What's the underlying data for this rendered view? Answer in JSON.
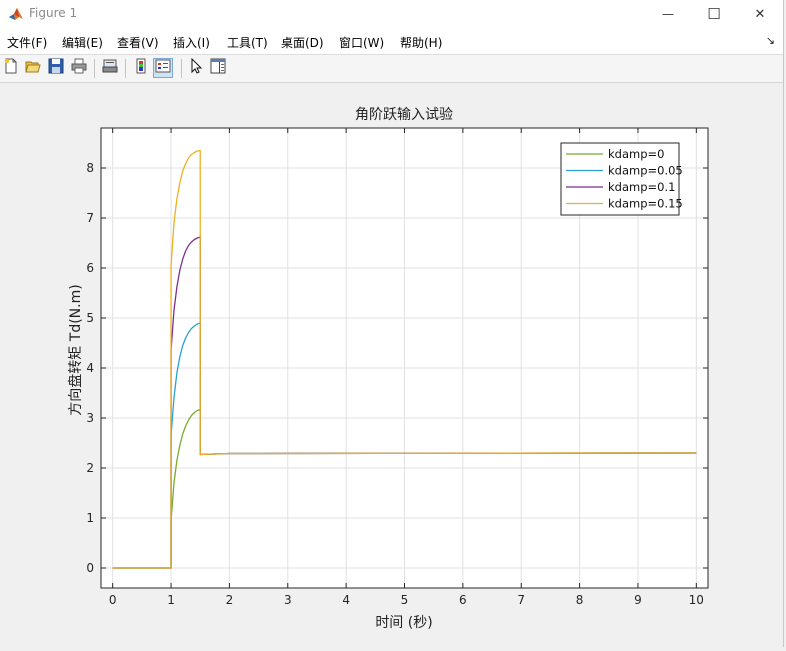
{
  "window": {
    "title": "Figure 1",
    "minimize_glyph": "—",
    "maximize_glyph": "☐",
    "close_glyph": "✕"
  },
  "menu": {
    "items": [
      {
        "label": "文件(F)"
      },
      {
        "label": "编辑(E)"
      },
      {
        "label": "查看(V)"
      },
      {
        "label": "插入(I)"
      },
      {
        "label": "工具(T)"
      },
      {
        "label": "桌面(D)"
      },
      {
        "label": "窗口(W)"
      },
      {
        "label": "帮助(H)"
      }
    ],
    "overflow_glyph": "↘"
  },
  "toolbar": {
    "icons": [
      "new-figure-icon",
      "open-file-icon",
      "save-icon",
      "print-icon",
      "print-preview-icon",
      "colorbar-icon",
      "legend-icon",
      "select-arrow-icon",
      "property-inspector-icon"
    ]
  },
  "chart_data": {
    "type": "line",
    "title": "角阶跃输入试验",
    "xlabel": "时间 (秒)",
    "ylabel": "方向盘转矩 Td(N.m)",
    "xlim": [
      -0.2,
      10.2
    ],
    "ylim": [
      -0.4,
      8.8
    ],
    "xticks": [
      0,
      1,
      2,
      3,
      4,
      5,
      6,
      7,
      8,
      9,
      10
    ],
    "yticks": [
      0,
      1,
      2,
      3,
      4,
      5,
      6,
      7,
      8
    ],
    "grid": true,
    "legend_position": "top-right",
    "series": [
      {
        "name": "kdamp=0",
        "color": "#77ac30",
        "x": [
          0,
          1,
          1,
          1.05,
          1.1,
          1.15,
          1.2,
          1.25,
          1.3,
          1.35,
          1.4,
          1.45,
          1.5,
          1.5,
          2,
          10
        ],
        "y": [
          0,
          0,
          0.95,
          1.7,
          2.15,
          2.45,
          2.68,
          2.84,
          2.96,
          3.05,
          3.11,
          3.15,
          3.17,
          2.27,
          2.29,
          2.3
        ]
      },
      {
        "name": "kdamp=0.05",
        "color": "#2a9fd6",
        "x": [
          0,
          1,
          1,
          1.05,
          1.1,
          1.15,
          1.2,
          1.25,
          1.3,
          1.35,
          1.4,
          1.45,
          1.5,
          1.5,
          2,
          10
        ],
        "y": [
          0,
          0,
          2.65,
          3.4,
          3.9,
          4.22,
          4.45,
          4.6,
          4.71,
          4.79,
          4.84,
          4.88,
          4.9,
          2.27,
          2.29,
          2.3
        ]
      },
      {
        "name": "kdamp=0.1",
        "color": "#7e2f8e",
        "x": [
          0,
          1,
          1,
          1.05,
          1.1,
          1.15,
          1.2,
          1.25,
          1.3,
          1.35,
          1.4,
          1.45,
          1.5,
          1.5,
          2,
          10
        ],
        "y": [
          0,
          0,
          4.35,
          5.15,
          5.62,
          5.95,
          6.18,
          6.34,
          6.45,
          6.52,
          6.57,
          6.6,
          6.62,
          2.27,
          2.29,
          2.3
        ]
      },
      {
        "name": "kdamp=0.15",
        "color": "#edb120",
        "x": [
          0,
          1,
          1,
          1.05,
          1.1,
          1.15,
          1.2,
          1.25,
          1.3,
          1.35,
          1.4,
          1.45,
          1.5,
          1.5,
          2,
          10
        ],
        "y": [
          0,
          0,
          6.05,
          6.9,
          7.38,
          7.7,
          7.94,
          8.09,
          8.2,
          8.27,
          8.31,
          8.34,
          8.35,
          2.27,
          2.29,
          2.3
        ]
      }
    ]
  }
}
